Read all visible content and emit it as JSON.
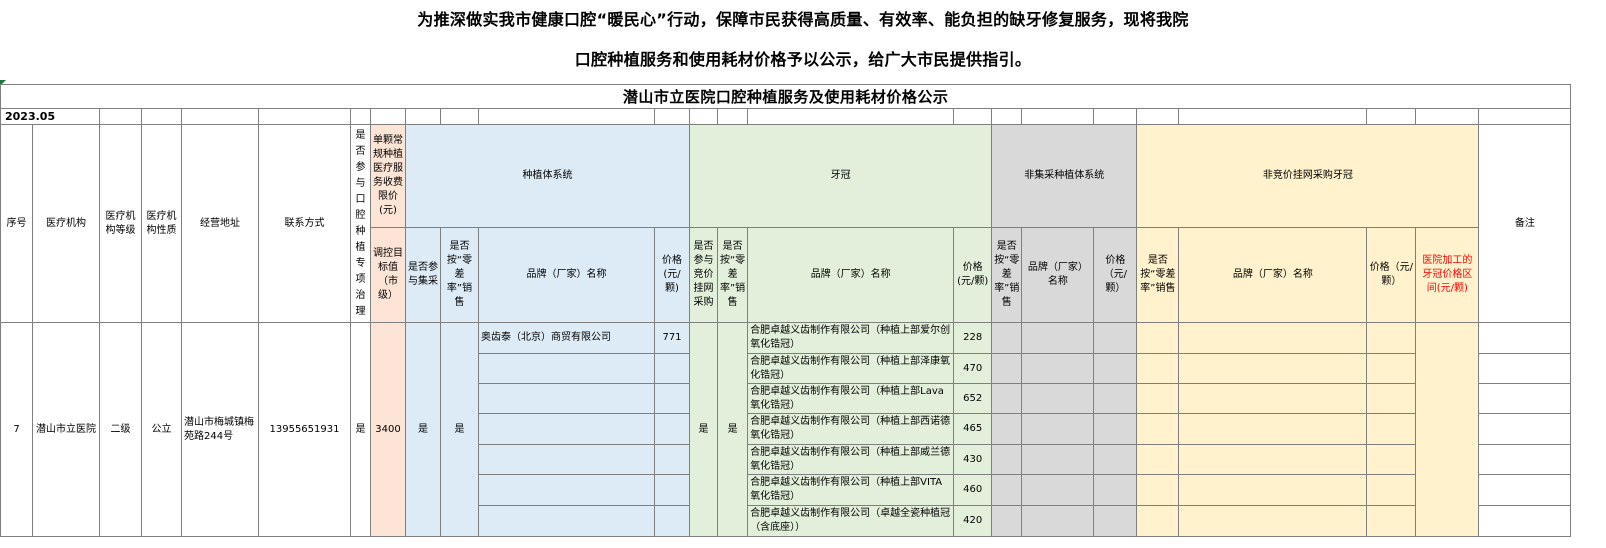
{
  "intro": {
    "line1": "为推深做实我市健康口腔“暖民心”行动，保障市民获得高质量、有效率、能负担的缺牙修复服务，现将我院",
    "line2": "口腔种植服务和使用耗材价格予以公示，给广大市民提供指引。"
  },
  "sheet_title": "潜山市立医院口腔种植服务及使用耗材价格公示",
  "date": "2023.05",
  "headers": {
    "seq": "序号",
    "institution": "医疗机构",
    "level": "医疗机构等级",
    "nature": "医疗机构性质",
    "address": "经营地址",
    "contact": "联系方式",
    "participate_vertical": "是否参与口腔种植专项治理",
    "single_fee": "单颗常规种植医疗服务收费限价(元)",
    "regulation_target": "调控目标值（市级）",
    "implant_system": "种植体系统",
    "crown": "牙冠",
    "non_central": "非集采种植体系统",
    "non_bid_crown": "非竞价挂网采购牙冠",
    "remark": "备注",
    "is_central": "是否参与集采",
    "zero_diff": "是否按“零差率”销售",
    "brand": "品牌（厂家）名称",
    "price_unit": "价格(元/颗)",
    "crown_bid": "是否参与竞价挂网采购",
    "crown_zero": "是否按“零差率”销售",
    "crown_brand": "品牌（厂家）名称",
    "crown_price": "价格(元/颗)",
    "nc_zero": "是否按“零差率”销售",
    "nc_brand": "品牌（厂家）名称",
    "nc_price": "价格（元/颗）",
    "nb_zero": "是否按“零差率”销售",
    "nb_brand": "品牌（厂家）名称",
    "nb_price": "价格（元/颗）",
    "hospital_crown_range": "医院加工的牙冠价格区间(元/颗)"
  },
  "record": {
    "seq": "7",
    "institution": "潜山市立医院",
    "level": "二级",
    "nature": "公立",
    "address": "潜山市梅城镇梅苑路244号",
    "contact": "13955651931",
    "participate": "是",
    "target": "3400",
    "implant_central": "是",
    "implant_zero": "是",
    "implant_brand": "奥齿泰（北京）商贸有限公司",
    "implant_price": "771",
    "crown_bid": "是",
    "crown_zero": "是"
  },
  "crowns": [
    {
      "brand": "合肥卓越义齿制作有限公司（种植上部爱尔创氧化锆冠）",
      "price": "228"
    },
    {
      "brand": "合肥卓越义齿制作有限公司（种植上部泽康氧化锆冠）",
      "price": "470"
    },
    {
      "brand": "合肥卓越义齿制作有限公司（种植上部Lava氧化锆冠）",
      "price": "652"
    },
    {
      "brand": "合肥卓越义齿制作有限公司（种植上部西诺德氧化锆冠）",
      "price": "465"
    },
    {
      "brand": "合肥卓越义齿制作有限公司（种植上部威兰德氧化锆冠）",
      "price": "430"
    },
    {
      "brand": "合肥卓越义齿制作有限公司（种植上部VITA氧化锆冠）",
      "price": "460"
    },
    {
      "brand": "合肥卓越义齿制作有限公司（卓越全瓷种植冠（含底座））",
      "price": "420"
    }
  ],
  "colors": {
    "implant_section": "#ddebf7",
    "crown_section": "#e2efda",
    "non_central_section": "#d9d9d9",
    "non_bid_section": "#fff2cc",
    "target_column": "#fce4d6",
    "highlight_text": "#ff0000"
  }
}
